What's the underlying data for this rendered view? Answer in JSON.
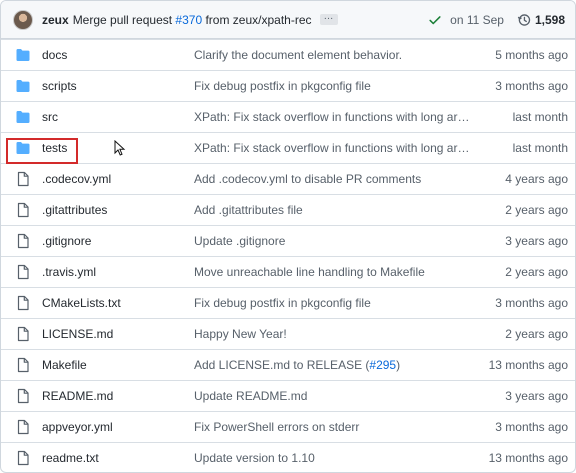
{
  "commit": {
    "author": "zeux",
    "message_prefix": "Merge pull request ",
    "pr_number": "#370",
    "message_suffix": " from zeux/xpath-rec",
    "ellipsis": "…",
    "date": "on 11 Sep",
    "history_count": "1,598"
  },
  "colors": {
    "folder": "#54aeff",
    "link": "#0969da",
    "check": "#1a7f37",
    "highlight": "#d32a2a"
  },
  "files": [
    {
      "type": "dir",
      "name": "docs",
      "message": "Clarify the document element behavior.",
      "age": "5 months ago"
    },
    {
      "type": "dir",
      "name": "scripts",
      "message": "Fix debug postfix in pkgconfig file",
      "age": "3 months ago"
    },
    {
      "type": "dir",
      "name": "src",
      "message": "XPath: Fix stack overflow in functions with long arg…",
      "age": "last month"
    },
    {
      "type": "dir",
      "name": "tests",
      "message": "XPath: Fix stack overflow in functions with long arg…",
      "age": "last month"
    },
    {
      "type": "file",
      "name": ".codecov.yml",
      "message": "Add .codecov.yml to disable PR comments",
      "age": "4 years ago"
    },
    {
      "type": "file",
      "name": ".gitattributes",
      "message": "Add .gitattributes file",
      "age": "2 years ago"
    },
    {
      "type": "file",
      "name": ".gitignore",
      "message": "Update .gitignore",
      "age": "3 years ago"
    },
    {
      "type": "file",
      "name": ".travis.yml",
      "message": "Move unreachable line handling to Makefile",
      "age": "2 years ago"
    },
    {
      "type": "file",
      "name": "CMakeLists.txt",
      "message": "Fix debug postfix in pkgconfig file",
      "age": "3 months ago"
    },
    {
      "type": "file",
      "name": "LICENSE.md",
      "message": "Happy New Year!",
      "age": "2 years ago"
    },
    {
      "type": "file",
      "name": "Makefile",
      "message": "Add LICENSE.md to RELEASE (",
      "message_link": "#295",
      "message_end": ")",
      "age": "13 months ago"
    },
    {
      "type": "file",
      "name": "README.md",
      "message": "Update README.md",
      "age": "3 years ago"
    },
    {
      "type": "file",
      "name": "appveyor.yml",
      "message": "Fix PowerShell errors on stderr",
      "age": "3 months ago"
    },
    {
      "type": "file",
      "name": "readme.txt",
      "message": "Update version to 1.10",
      "age": "13 months ago"
    }
  ]
}
